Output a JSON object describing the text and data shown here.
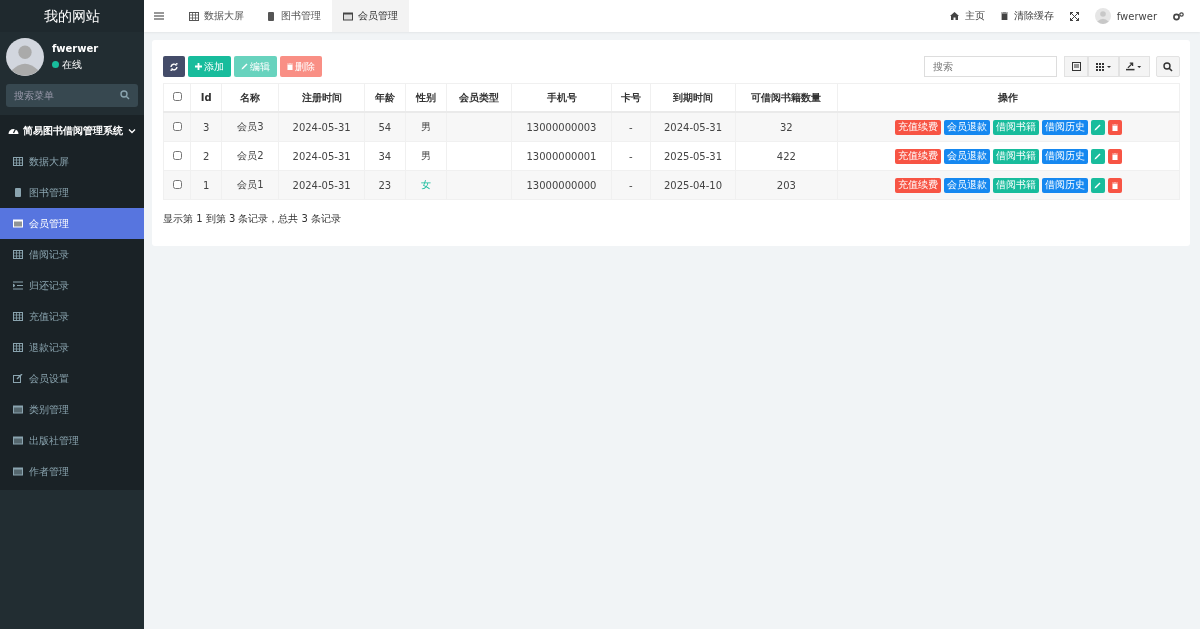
{
  "sidebar": {
    "logo": "我的网站",
    "user": {
      "name": "fwerwer",
      "status": "在线"
    },
    "search": {
      "placeholder": "搜索菜单"
    },
    "group": {
      "label": "简易图书借阅管理系统",
      "expanded": true
    },
    "items": [
      {
        "label": "数据大屏",
        "kind": "table",
        "selected": false
      },
      {
        "label": "图书管理",
        "kind": "book",
        "selected": false
      },
      {
        "label": "会员管理",
        "kind": "list",
        "selected": true
      },
      {
        "label": "借阅记录",
        "kind": "table",
        "selected": false
      },
      {
        "label": "归还记录",
        "kind": "indent",
        "selected": false
      },
      {
        "label": "充值记录",
        "kind": "table",
        "selected": false
      },
      {
        "label": "退款记录",
        "kind": "table",
        "selected": false
      },
      {
        "label": "会员设置",
        "kind": "edit",
        "selected": false
      },
      {
        "label": "类别管理",
        "kind": "list",
        "selected": false
      },
      {
        "label": "出版社管理",
        "kind": "list",
        "selected": false
      },
      {
        "label": "作者管理",
        "kind": "list",
        "selected": false
      }
    ]
  },
  "tabs": [
    {
      "label": "数据大屏",
      "kind": "table",
      "selected": false
    },
    {
      "label": "图书管理",
      "kind": "book",
      "selected": false
    },
    {
      "label": "会员管理",
      "kind": "list",
      "selected": true
    }
  ],
  "topbar": {
    "home": "主页",
    "clear_cache": "清除缓存",
    "user": "fwerwer"
  },
  "toolbar": {
    "buttons": [
      {
        "kind": "refresh",
        "disabled": false
      },
      {
        "kind": "add",
        "label": "添加",
        "disabled": false
      },
      {
        "kind": "edit",
        "label": "编辑",
        "disabled": true
      },
      {
        "kind": "delete",
        "label": "删除",
        "disabled": true
      }
    ],
    "search": {
      "placeholder": "搜索"
    }
  },
  "table": {
    "all_checked": false,
    "columns": [
      "Id",
      "名称",
      "注册时间",
      "年龄",
      "性别",
      "会员类型",
      "手机号",
      "卡号",
      "到期时间",
      "可借阅书籍数量",
      "操作"
    ],
    "rows": [
      {
        "checked": false,
        "id": "3",
        "name": "会员3",
        "registered": "2024-05-31",
        "age": "54",
        "gender": {
          "text": "男",
          "kind": "male"
        },
        "phone": "13000000003",
        "card": "-",
        "expires": "2024-05-31",
        "quota": "32",
        "actions": [
          {
            "kind": "red",
            "label": "充值续费"
          },
          {
            "kind": "blue",
            "label": "会员退款"
          },
          {
            "kind": "green",
            "label": "借阅书籍"
          },
          {
            "kind": "blue",
            "label": "借阅历史"
          },
          {
            "kind": "edit"
          },
          {
            "kind": "delete"
          }
        ]
      },
      {
        "checked": false,
        "id": "2",
        "name": "会员2",
        "registered": "2024-05-31",
        "age": "34",
        "gender": {
          "text": "男",
          "kind": "male"
        },
        "phone": "13000000001",
        "card": "-",
        "expires": "2025-05-31",
        "quota": "422",
        "actions": [
          {
            "kind": "red",
            "label": "充值续费"
          },
          {
            "kind": "blue",
            "label": "会员退款"
          },
          {
            "kind": "green",
            "label": "借阅书籍"
          },
          {
            "kind": "blue",
            "label": "借阅历史"
          },
          {
            "kind": "edit"
          },
          {
            "kind": "delete"
          }
        ]
      },
      {
        "checked": false,
        "id": "1",
        "name": "会员1",
        "registered": "2024-05-31",
        "age": "23",
        "gender": {
          "text": "女",
          "kind": "female"
        },
        "phone": "13000000000",
        "card": "-",
        "expires": "2025-04-10",
        "quota": "203",
        "actions": [
          {
            "kind": "red",
            "label": "充值续费"
          },
          {
            "kind": "blue",
            "label": "会员退款"
          },
          {
            "kind": "green",
            "label": "借阅书籍"
          },
          {
            "kind": "blue",
            "label": "借阅历史"
          },
          {
            "kind": "edit"
          },
          {
            "kind": "delete"
          }
        ]
      }
    ],
    "footer": "显示第 1 到第 3 条记录，总共 3 条记录"
  }
}
